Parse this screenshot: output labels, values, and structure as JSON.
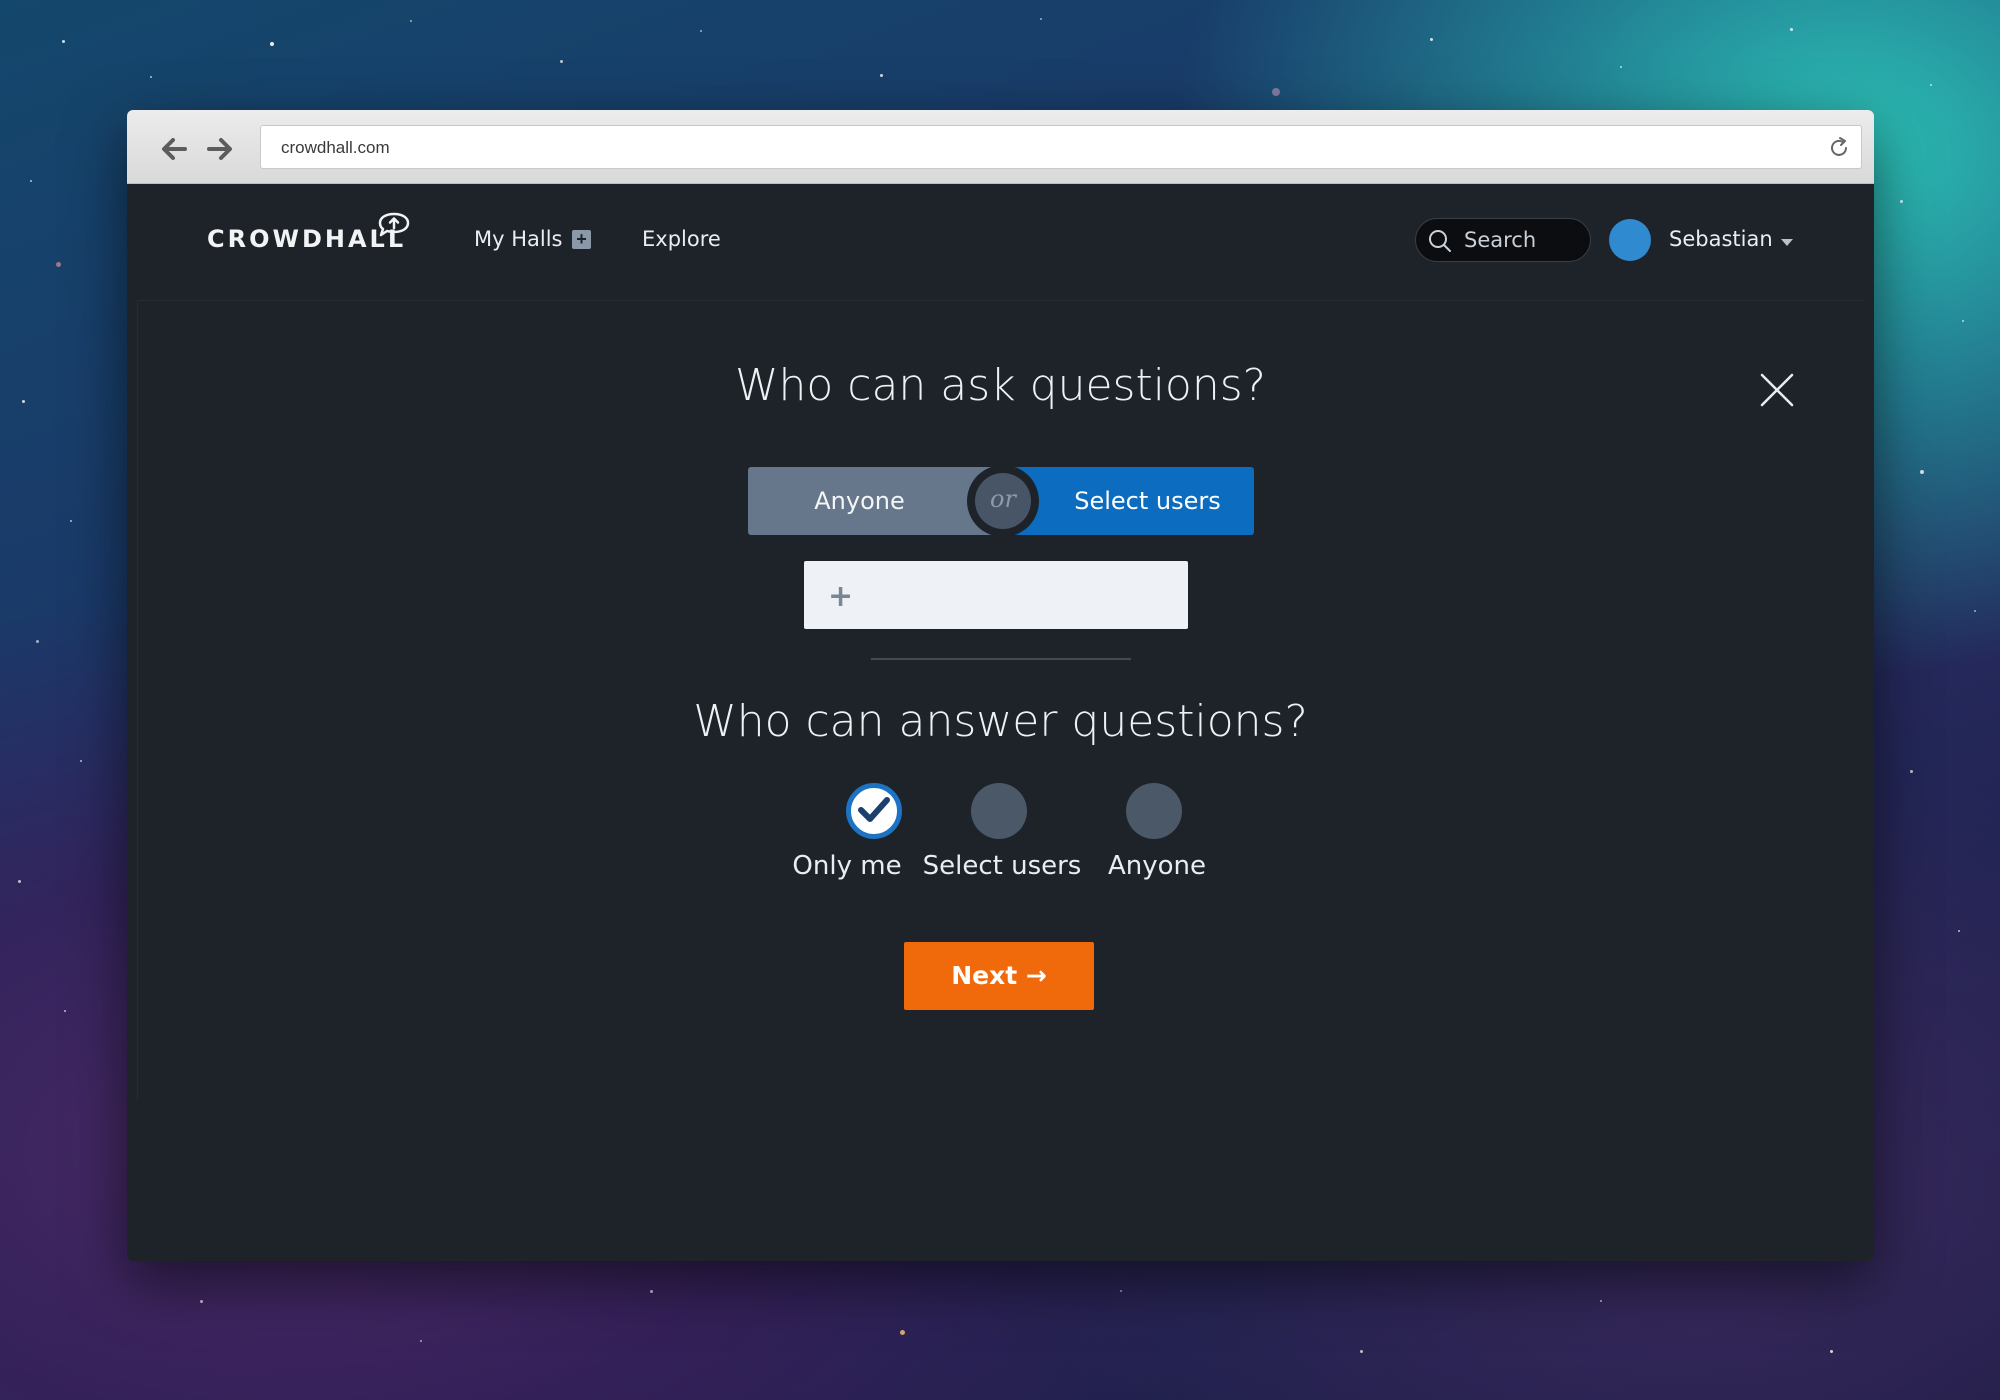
{
  "browser": {
    "url": "crowdhall.com",
    "back_icon": "back-arrow-icon",
    "forward_icon": "forward-arrow-icon",
    "reload_icon": "reload-icon"
  },
  "header": {
    "logo_text": "CROWDHALL",
    "nav": {
      "my_halls": "My Halls",
      "add_hall": "+",
      "explore": "Explore"
    },
    "search_placeholder": "Search",
    "user_name": "Sebastian"
  },
  "ask": {
    "title": "Who can ask questions?",
    "option_left": "Anyone",
    "separator": "or",
    "option_right": "Select users",
    "selected": "Select users",
    "add_field_value": "",
    "add_icon": "+"
  },
  "answer": {
    "title": "Who can answer questions?",
    "options": [
      {
        "label": "Only me",
        "checked": true
      },
      {
        "label": "Select users",
        "checked": false
      },
      {
        "label": "Anyone",
        "checked": false
      }
    ]
  },
  "next_button": "Next →",
  "colors": {
    "accent_blue": "#0b6cc0",
    "next_orange": "#f06a0b",
    "panel_bg": "#1e2329",
    "segment_inactive": "#66778b"
  }
}
